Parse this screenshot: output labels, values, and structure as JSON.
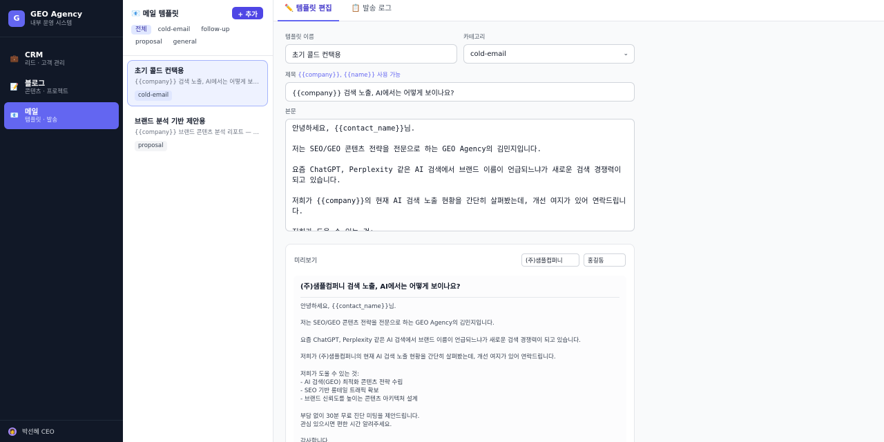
{
  "brand": {
    "logo": "G",
    "title": "GEO Agency",
    "subtitle": "내부 운영 시스템"
  },
  "nav": [
    {
      "icon": "briefcase-icon",
      "glyph": "💼",
      "label": "CRM",
      "sub": "리드 · 고객 관리",
      "active": false
    },
    {
      "icon": "memo-icon",
      "glyph": "📝",
      "label": "블로그",
      "sub": "콘텐츠 · 프로젝트",
      "active": false
    },
    {
      "icon": "envelope-icon",
      "glyph": "📧",
      "label": "메일",
      "sub": "템플릿 · 발송",
      "active": true
    }
  ],
  "user": {
    "name": "박선혜 CEO"
  },
  "templates_panel": {
    "title": "📧 메일 템플릿",
    "add_label": "+ 추가",
    "filters": [
      "전체",
      "cold-email",
      "follow-up",
      "proposal",
      "general"
    ],
    "active_filter": "전체",
    "items": [
      {
        "title": "초기 콜드 컨택용",
        "preview": "{{company}} 검색 노출, AI에서는 어떻게 보이나요?",
        "tag": "cold-email",
        "selected": true
      },
      {
        "title": "브랜드 분석 기반 제안용",
        "preview": "{{company}} 브랜드 콘텐츠 분석 리포트 — 무료 제공",
        "tag": "proposal",
        "selected": false
      }
    ]
  },
  "tabs": [
    {
      "label": "✏️ 템플릿 편집",
      "active": true
    },
    {
      "label": "📋 발송 로그",
      "active": false
    }
  ],
  "form": {
    "name_label": "템플릿 이름",
    "name_value": "초기 콜드 컨택용",
    "category_label": "카테고리",
    "category_value": "cold-email",
    "subject_label": "제목",
    "subject_hint": "{{company}}, {{name}} 사용 가능",
    "subject_value": "{{company}} 검색 노출, AI에서는 어떻게 보이나요?",
    "body_label": "본문",
    "body_value": "안녕하세요, {{contact_name}}님.\n\n저는 SEO/GEO 콘텐츠 전략을 전문으로 하는 GEO Agency의 김민지입니다.\n\n요즘 ChatGPT, Perplexity 같은 AI 검색에서 브랜드 이름이 언급되느냐가 새로운 검색 경쟁력이 되고 있습니다.\n\n저희가 {{company}}의 현재 AI 검색 노출 현황을 간단히 살펴봤는데, 개선 여지가 있어 연락드립니다.\n\n저희가 도울 수 있는 것:\n- AI 검색(GEO) 최적화 콘텐츠 전략 수립"
  },
  "preview": {
    "label": "미리보기",
    "company": "(주)샘플컴퍼니",
    "name": "홍길동",
    "subject": "(주)샘플컴퍼니 검색 노출, AI에서는 어떻게 보이나요?",
    "body": "안녕하세요, {{contact_name}}님.\n\n저는 SEO/GEO 콘텐츠 전략을 전문으로 하는 GEO Agency의 김민지입니다.\n\n요즘 ChatGPT, Perplexity 같은 AI 검색에서 브랜드 이름이 언급되느냐가 새로운 검색 경쟁력이 되고 있습니다.\n\n저희가 (주)샘플컴퍼니의 현재 AI 검색 노출 현황을 간단히 살펴봤는데, 개선 여지가 있어 연락드립니다.\n\n저희가 도울 수 있는 것:\n- AI 검색(GEO) 최적화 콘텐츠 전략 수립\n- SEO 기반 롱테일 트래픽 확보\n- 브랜드 신뢰도를 높이는 콘텐츠 아키텍처 설계\n\n부담 없이 30분 무료 진단 미팅을 제안드립니다.\n관심 있으시면 편한 시간 알려주세요.\n\n감사합니다.\n김민지 드림"
  }
}
